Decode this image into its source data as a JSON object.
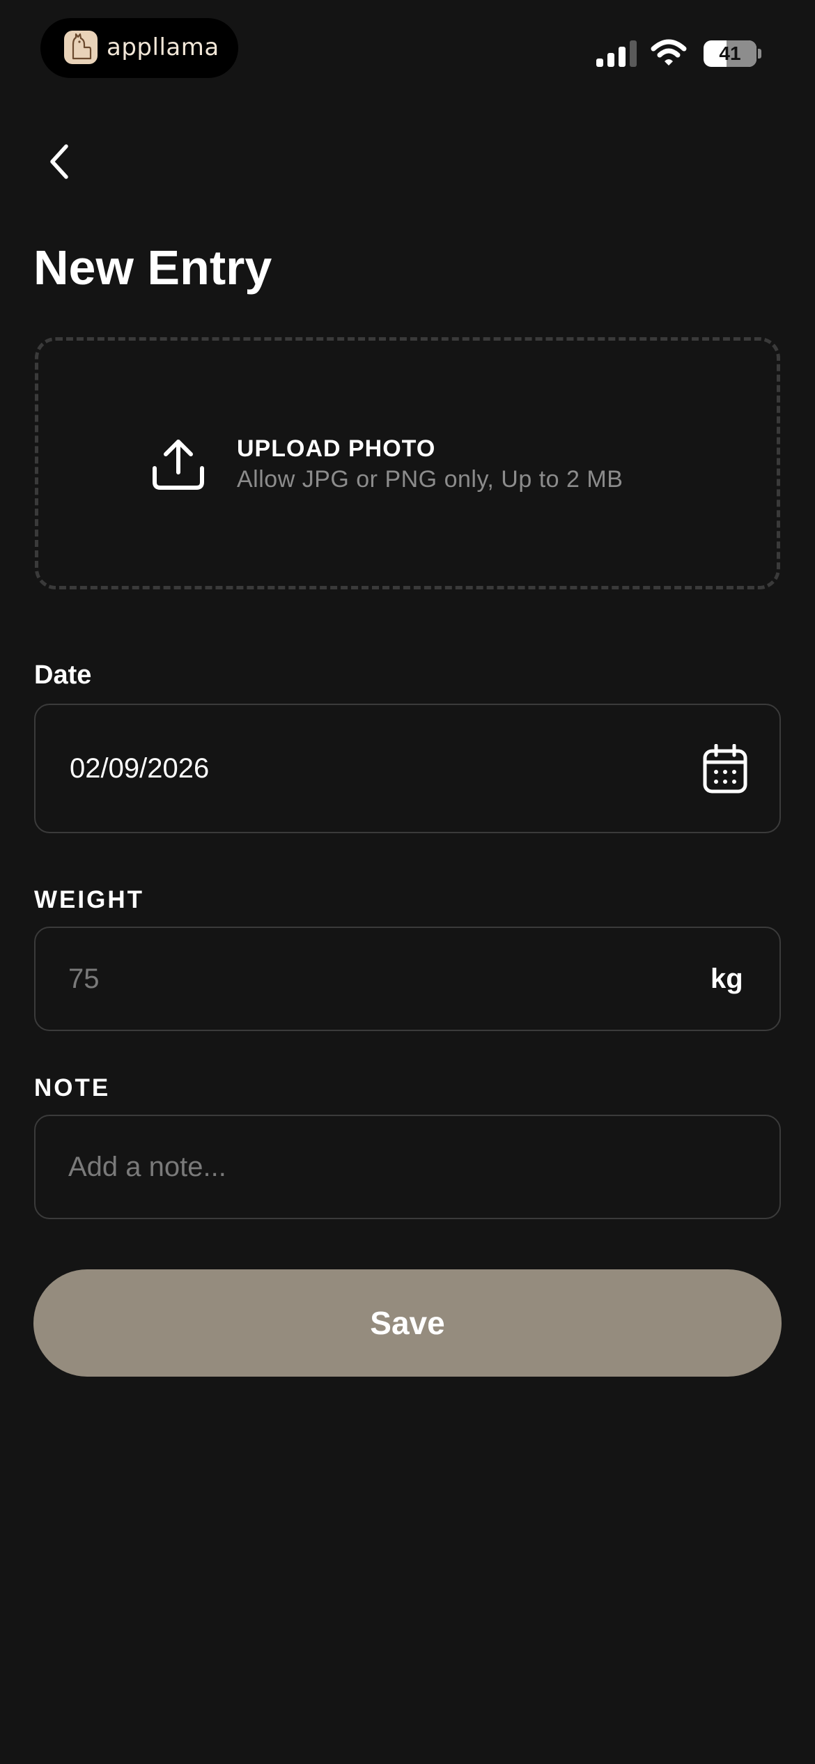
{
  "status_bar": {
    "brand_name": "appllama",
    "battery_level": "41",
    "signal_bars": 3
  },
  "header": {
    "title": "New Entry",
    "back_icon": "chevron-left-icon"
  },
  "upload": {
    "icon": "upload-icon",
    "title": "UPLOAD PHOTO",
    "hint": "Allow JPG or PNG only, Up to 2 MB"
  },
  "date_field": {
    "label": "Date",
    "value": "02/09/2026",
    "icon": "calendar-icon"
  },
  "weight_field": {
    "label": "WEIGHT",
    "placeholder": "75",
    "unit": "kg"
  },
  "note_field": {
    "label": "NOTE",
    "placeholder": "Add a note..."
  },
  "save_button": {
    "label": "Save"
  },
  "colors": {
    "background": "#141414",
    "field_border": "#3b3b3b",
    "button": "#958c7e",
    "muted_text": "#8c8c8c"
  }
}
